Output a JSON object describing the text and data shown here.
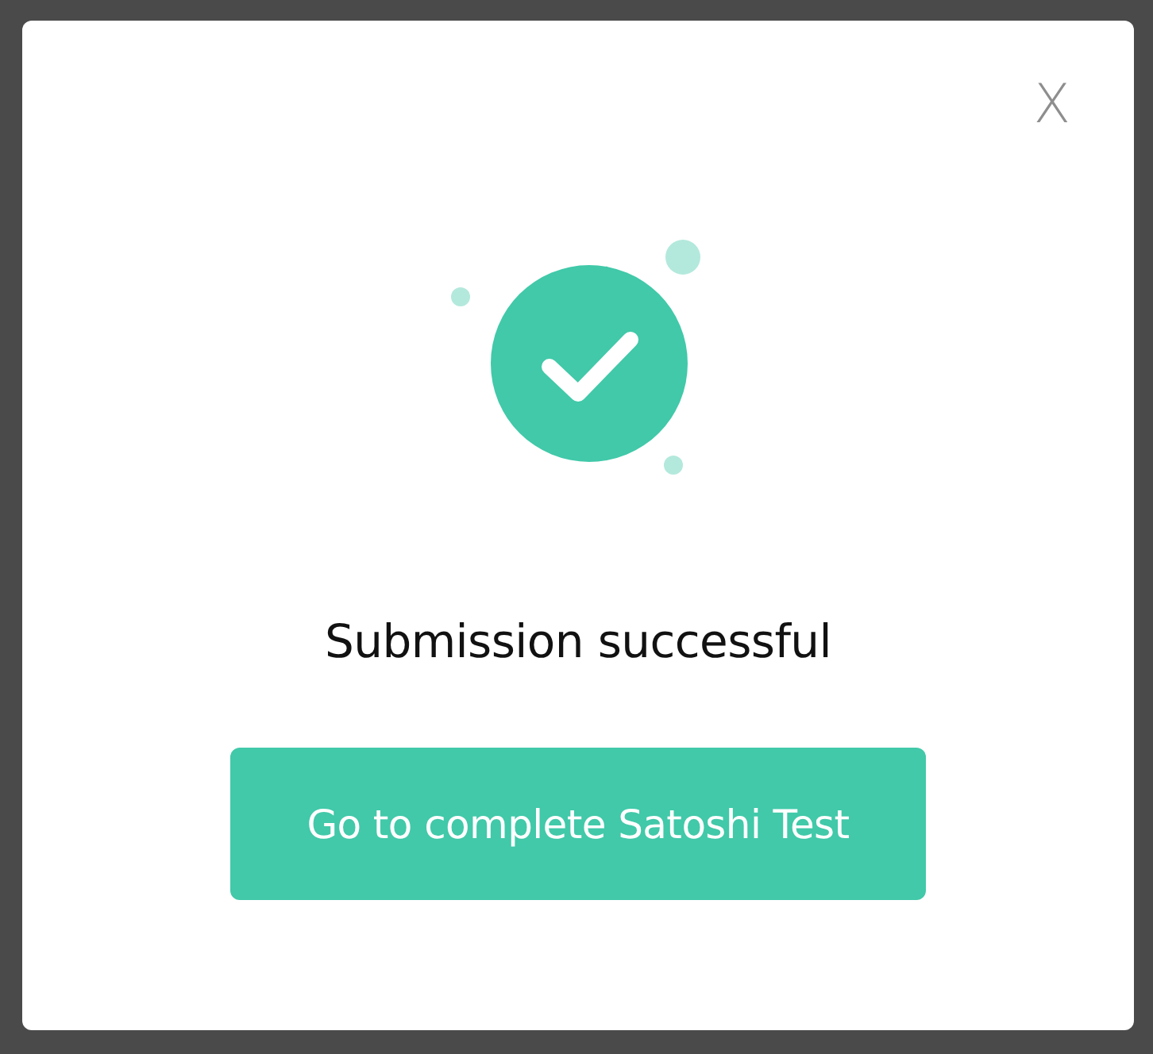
{
  "dialog": {
    "close": "X",
    "message": "Submission successful",
    "button": "Go to complete Satoshi Test"
  }
}
